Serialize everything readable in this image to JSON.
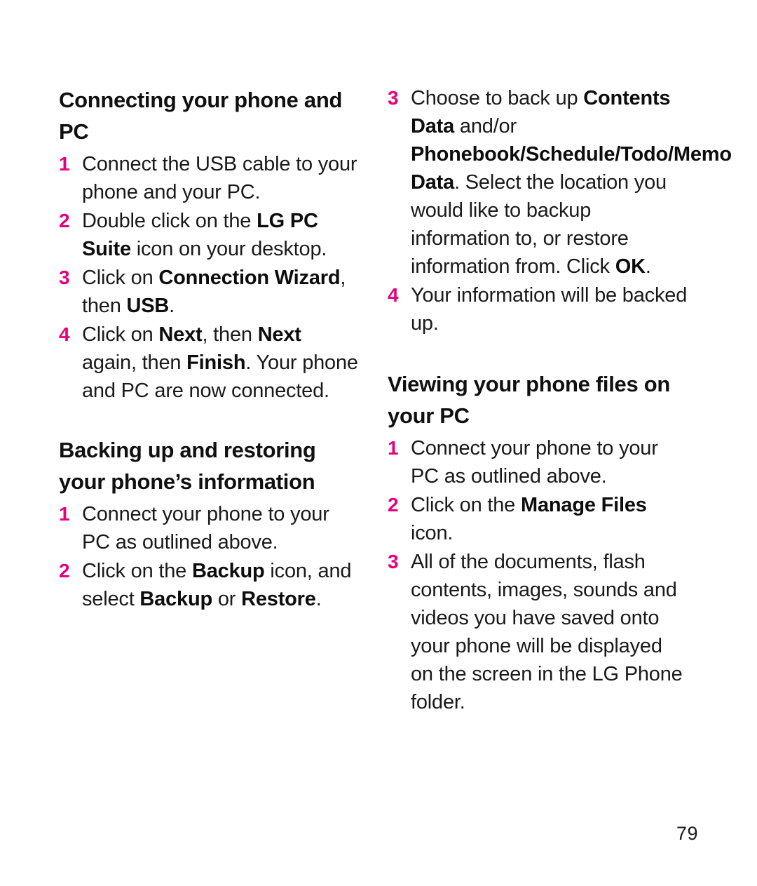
{
  "page": {
    "number": "79",
    "background_color": "#ffffff",
    "accent_color": "#e6007e",
    "text_color": "#1a1a1a"
  },
  "left_column": {
    "sections": [
      {
        "heading": "Connecting your phone and PC",
        "steps": [
          {
            "marker": "1",
            "runs": [
              {
                "text": "Connect the USB cable to your phone and your PC.",
                "bold": false
              }
            ]
          },
          {
            "marker": "2",
            "runs": [
              {
                "text": "Double click on the ",
                "bold": false
              },
              {
                "text": "LG PC Suite",
                "bold": true
              },
              {
                "text": " icon on your desktop.",
                "bold": false
              }
            ]
          },
          {
            "marker": "3",
            "runs": [
              {
                "text": "Click on ",
                "bold": false
              },
              {
                "text": "Connection Wizard",
                "bold": true
              },
              {
                "text": ", then ",
                "bold": false
              },
              {
                "text": "USB",
                "bold": true
              },
              {
                "text": ".",
                "bold": false
              }
            ]
          },
          {
            "marker": "4",
            "runs": [
              {
                "text": "Click on ",
                "bold": false
              },
              {
                "text": "Next",
                "bold": true
              },
              {
                "text": ", then ",
                "bold": false
              },
              {
                "text": "Next",
                "bold": true
              },
              {
                "text": " again, then ",
                "bold": false
              },
              {
                "text": "Finish",
                "bold": true
              },
              {
                "text": ". Your phone and PC are now connected.",
                "bold": false
              }
            ]
          }
        ]
      },
      {
        "heading": "Backing up and restoring your phone’s information",
        "steps": [
          {
            "marker": "1",
            "runs": [
              {
                "text": "Connect your phone to your PC as outlined above.",
                "bold": false
              }
            ]
          },
          {
            "marker": "2",
            "runs": [
              {
                "text": "Click on the ",
                "bold": false
              },
              {
                "text": "Backup",
                "bold": true
              },
              {
                "text": " icon, and select ",
                "bold": false
              },
              {
                "text": "Backup",
                "bold": true
              },
              {
                "text": " or ",
                "bold": false
              },
              {
                "text": "Restore",
                "bold": true
              },
              {
                "text": ".",
                "bold": false
              }
            ]
          }
        ]
      }
    ]
  },
  "right_column": {
    "sections": [
      {
        "heading": "",
        "steps": [
          {
            "marker": "3",
            "runs": [
              {
                "text": "Choose to back up ",
                "bold": false
              },
              {
                "text": "Contents Data",
                "bold": true
              },
              {
                "text": " and/or ",
                "bold": false
              },
              {
                "text": "Phonebook/Schedule/Todo/Memo Data",
                "bold": true
              },
              {
                "text": ". Select the location you would like to backup information to, or restore information from. Click ",
                "bold": false
              },
              {
                "text": "OK",
                "bold": true
              },
              {
                "text": ".",
                "bold": false
              }
            ]
          },
          {
            "marker": "4",
            "runs": [
              {
                "text": "Your information will be backed up.",
                "bold": false
              }
            ]
          }
        ]
      },
      {
        "heading": "Viewing your phone files on your PC",
        "steps": [
          {
            "marker": "1",
            "runs": [
              {
                "text": "Connect your phone to your PC as outlined above.",
                "bold": false
              }
            ]
          },
          {
            "marker": "2",
            "runs": [
              {
                "text": "Click on the ",
                "bold": false
              },
              {
                "text": "Manage Files",
                "bold": true
              },
              {
                "text": " icon.",
                "bold": false
              }
            ]
          },
          {
            "marker": "3",
            "runs": [
              {
                "text": "All of the documents, flash contents, images, sounds and videos you have saved onto your phone will be displayed on the screen in the LG Phone folder.",
                "bold": false
              }
            ]
          }
        ]
      }
    ]
  }
}
